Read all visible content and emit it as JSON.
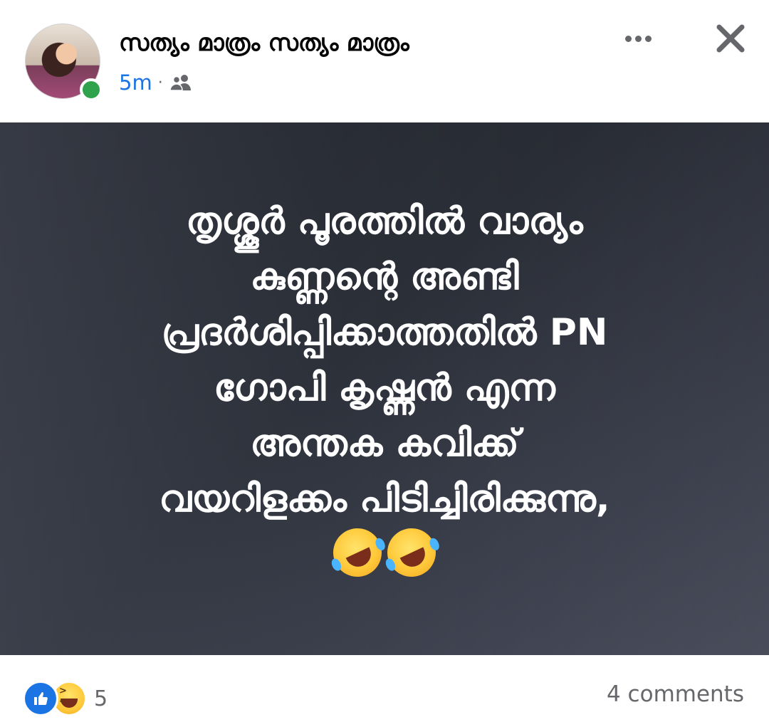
{
  "header": {
    "page_name": "സത്യം മാത്രം സത്യം മാത്രം",
    "time": "5m",
    "separator": "·",
    "audience_icon": "friends-icon",
    "online_color": "#31a24c",
    "accent_color": "#1b74e4"
  },
  "post": {
    "lines": [
      "തൃശ്ശൂർ പൂരത്തിൽ വാര്യം",
      "കുണ്ണന്റെ അണ്ടി",
      "പ്രദർശിപ്പിക്കാത്തതിൽ PN",
      "ഗോപി കൃഷ്ണൻ എന്ന",
      "അന്തക കവിക്ക്",
      "വയറിളക്കം പിടിച്ചിരിക്കുന്നു,"
    ],
    "emojis": [
      "rolling-on-floor-laughing-emoji",
      "rolling-on-floor-laughing-emoji"
    ]
  },
  "footer": {
    "reaction_icons": [
      "like-icon",
      "haha-icon"
    ],
    "reaction_count": "5",
    "comments": "4 comments"
  }
}
